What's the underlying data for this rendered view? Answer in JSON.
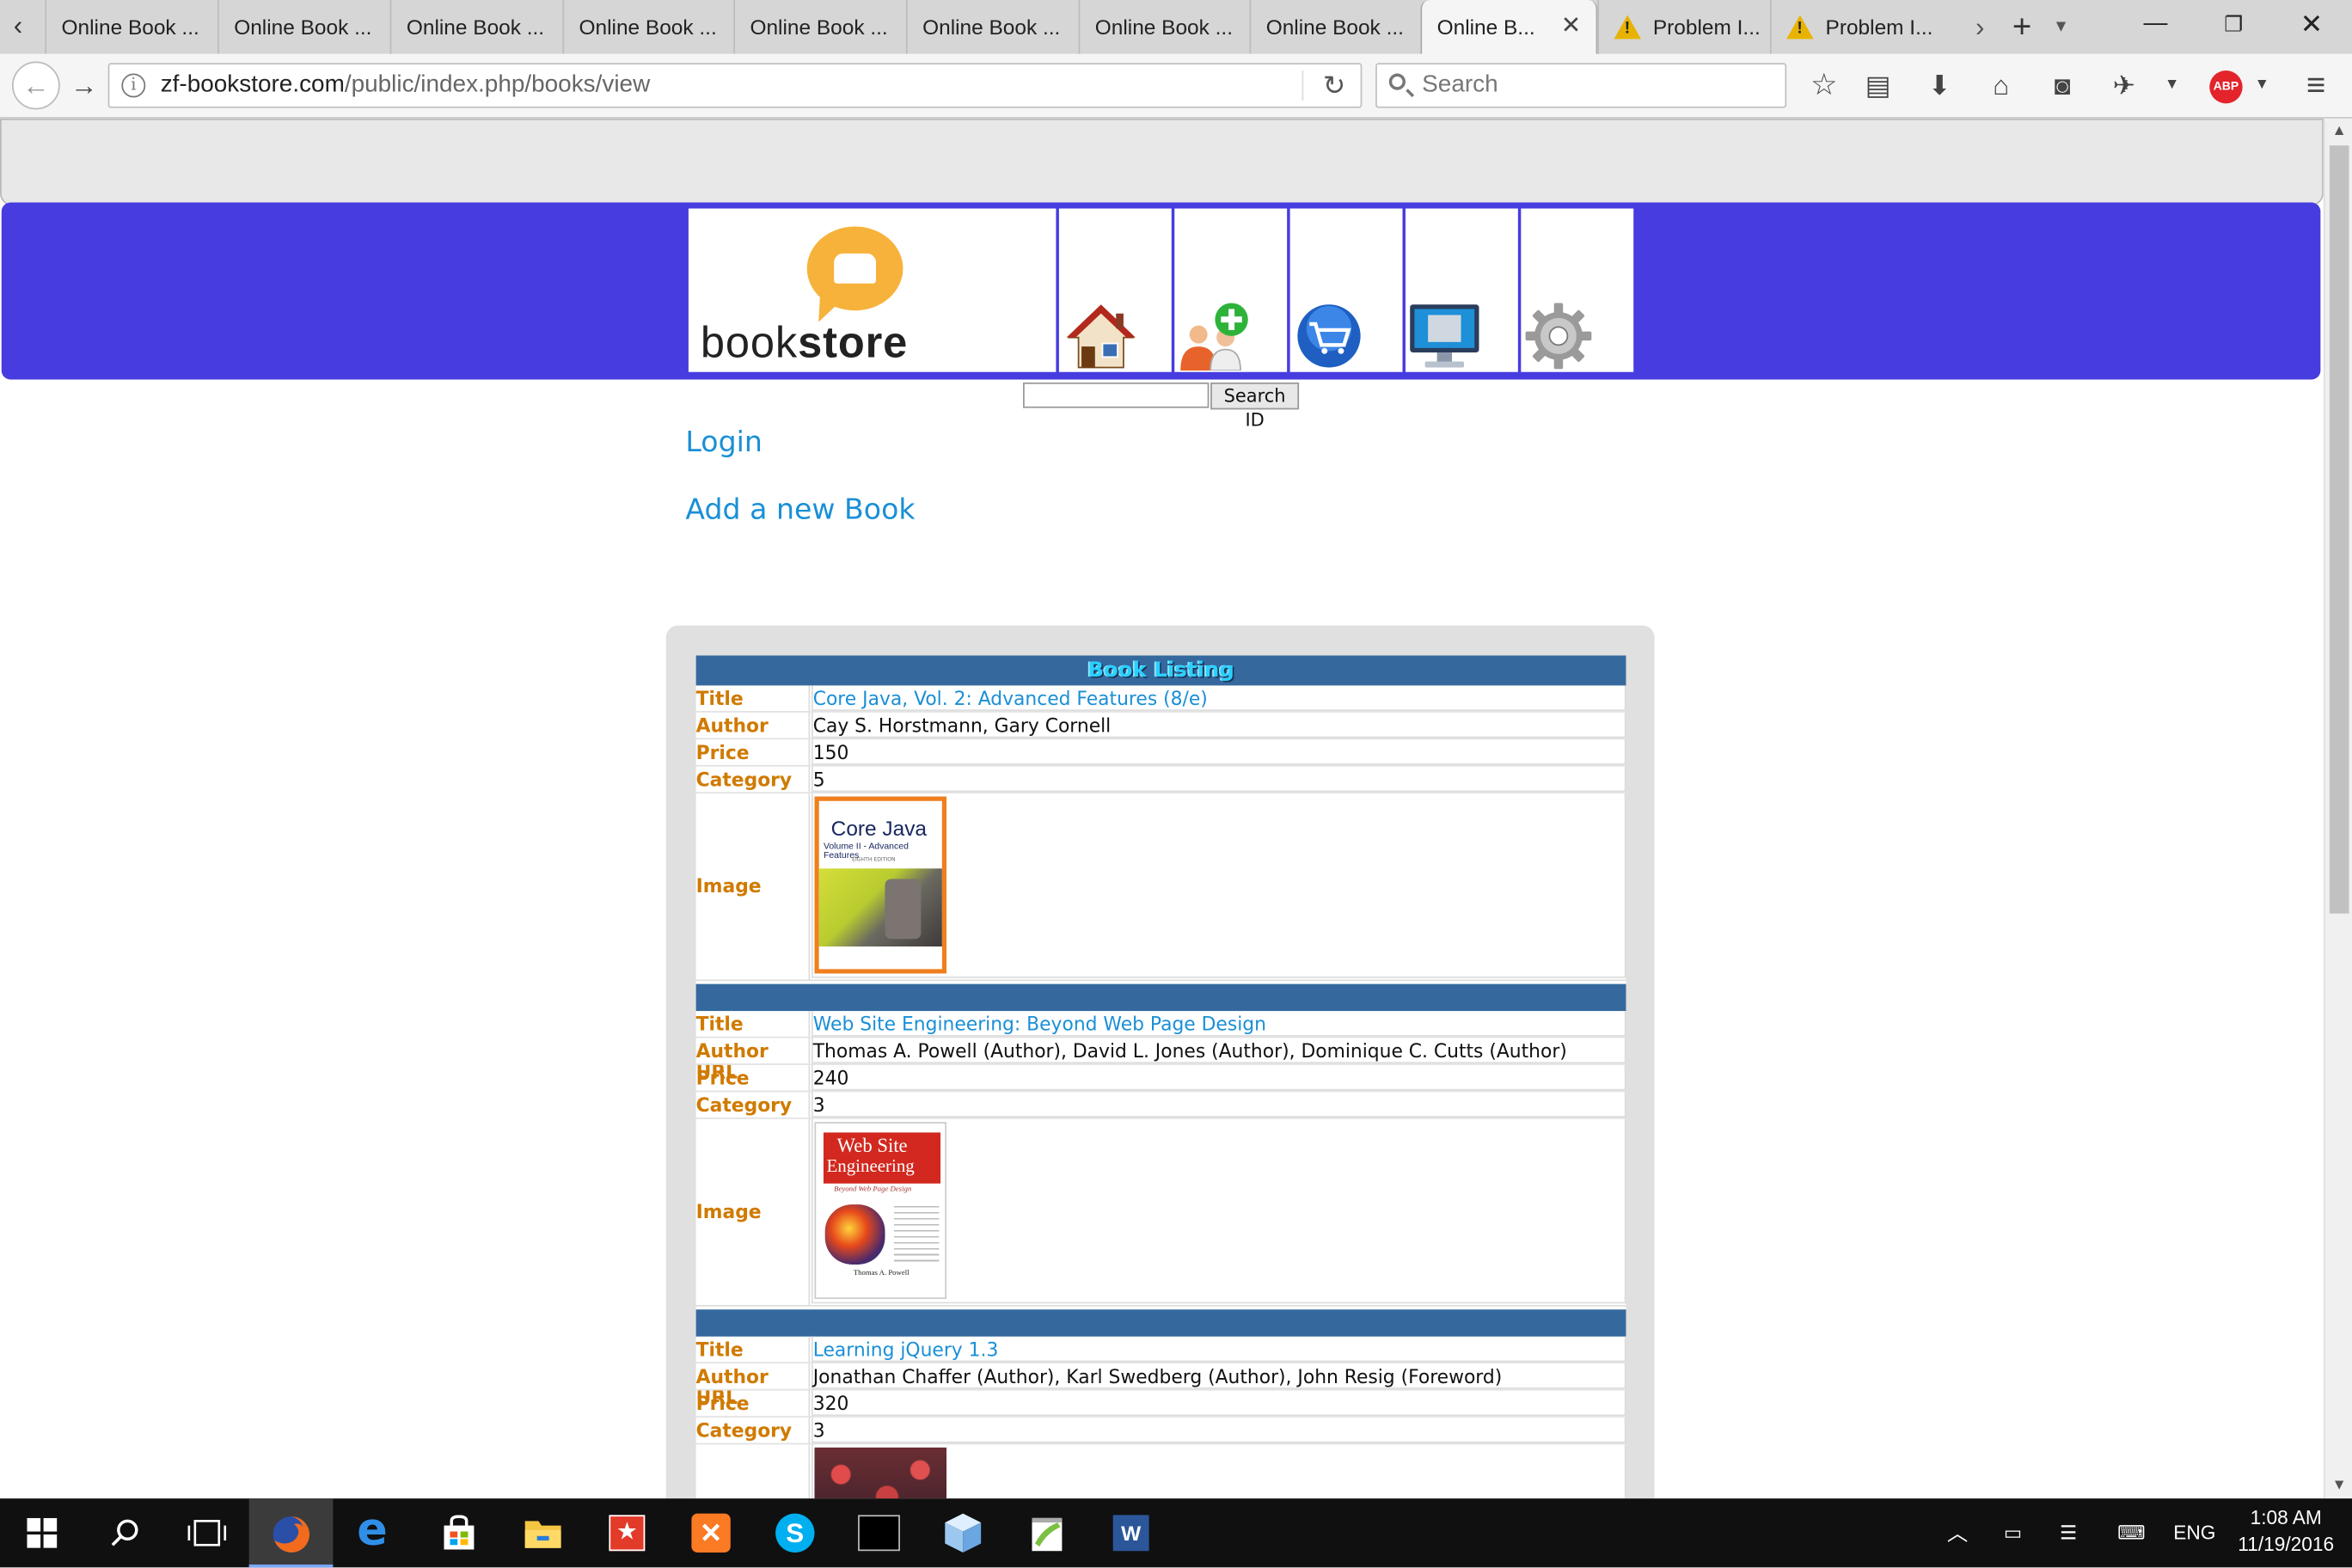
{
  "browser": {
    "tabs": [
      {
        "label": "Online Book ...",
        "active": false
      },
      {
        "label": "Online Book ...",
        "active": false
      },
      {
        "label": "Online Book ...",
        "active": false
      },
      {
        "label": "Online Book ...",
        "active": false
      },
      {
        "label": "Online Book ...",
        "active": false
      },
      {
        "label": "Online Book ...",
        "active": false
      },
      {
        "label": "Online Book ...",
        "active": false
      },
      {
        "label": "Online Book ...",
        "active": false
      },
      {
        "label": "Online B...",
        "active": true
      },
      {
        "label": "Problem I...",
        "active": false,
        "icon": "warning-icon"
      },
      {
        "label": "Problem I...",
        "active": false,
        "icon": "warning-icon"
      }
    ],
    "url_host": "zf-bookstore.com",
    "url_path": "/public/index.php/books/view",
    "search_placeholder": "Search",
    "adblock_label": "ABP"
  },
  "site": {
    "logo_text_light": "book",
    "logo_text_bold": "store",
    "nav_icons": [
      "home-icon",
      "add-user-icon",
      "cart-icon",
      "monitor-icon",
      "gear-icon"
    ],
    "search_button": "Search ID",
    "login_link": "Login",
    "add_book_link": "Add a new Book"
  },
  "listing": {
    "title": "Book Listing",
    "labels": {
      "title": "Title",
      "author": "Author",
      "price": "Price",
      "category": "Category",
      "image": "Image URL"
    },
    "books": [
      {
        "title": "Core Java, Vol. 2: Advanced Features (8/e)",
        "author": "Cay S. Horstmann, Gary Cornell",
        "price": "150",
        "category": "5",
        "cover": {
          "line1": "Core Java",
          "line2": "Volume II - Advanced Features",
          "line3": "EIGHTH EDITION"
        }
      },
      {
        "title": "Web Site Engineering: Beyond Web Page Design",
        "author": "Thomas A. Powell (Author), David L. Jones (Author), Dominique C. Cutts (Author)",
        "price": "240",
        "category": "3",
        "cover": {
          "line1": "Web Site",
          "line2": "Engineering",
          "line3": "Beyond Web Page Design",
          "line4": "Thomas A. Powell"
        }
      },
      {
        "title": "Learning jQuery 1.3",
        "author": "Jonathan Chaffer (Author), Karl Swedberg (Author), John Resig (Foreword)",
        "price": "320",
        "category": "3"
      }
    ]
  },
  "taskbar": {
    "apps": [
      "windows-start-icon",
      "search-icon",
      "task-view-icon",
      "firefox-icon",
      "edge-icon",
      "store-icon",
      "file-explorer-icon",
      "app-icon",
      "xampp-icon",
      "skype-icon",
      "terminal-icon",
      "cube-app-icon",
      "notepad-plus-icon",
      "word-icon"
    ],
    "language": "ENG",
    "time": "1:08 AM",
    "date": "11/19/2016"
  }
}
